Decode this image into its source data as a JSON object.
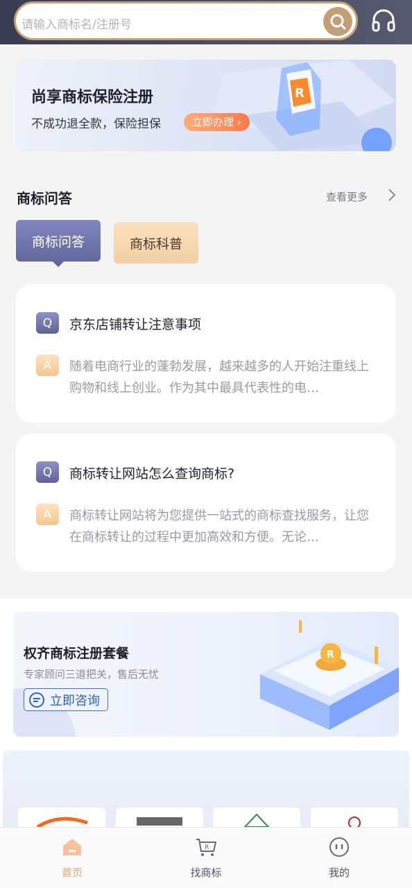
{
  "header": {
    "search_placeholder": "请输入商标名/注册号",
    "search_icon": "search-icon",
    "service_icon": "headset-icon"
  },
  "banner": {
    "title": "尚享商标保险注册",
    "subtitle": "不成功退全款，保险担保",
    "cta": "立即办理 ›"
  },
  "qa_section": {
    "title": "商标问答",
    "more": "查看更多",
    "tabs": [
      {
        "label": "商标问答",
        "active": true
      },
      {
        "label": "商标科普",
        "active": false
      }
    ],
    "items": [
      {
        "q_badge": "Q",
        "question": "京东店铺转让注意事项",
        "a_badge": "A",
        "answer": "随着电商行业的蓬勃发展，越来越多的人开始注重线上购物和线上创业。作为其中最具代表性的电…"
      },
      {
        "q_badge": "Q",
        "question": "商标转让网站怎么查询商标?",
        "a_badge": "A",
        "answer": "商标转让网站将为您提供一站式的商标查找服务，让您在商标转让的过程中更加高效和方便。无论…"
      }
    ]
  },
  "promo": {
    "title": "权齐商标注册套餐",
    "subtitle": "专家顾问三道把关，售后无忧",
    "cta": "立即咨询"
  },
  "nav": {
    "items": [
      {
        "label": "首页",
        "icon": "home-icon",
        "active": true
      },
      {
        "label": "找商标",
        "icon": "cart-icon",
        "active": false
      },
      {
        "label": "我的",
        "icon": "profile-icon",
        "active": false
      }
    ]
  },
  "colors": {
    "accent_gold": "#c39f78",
    "tab_active": "#63679c",
    "tab_inactive": "#f3cfa3",
    "link_blue": "#2e5fc9",
    "nav_active": "#e8a46f"
  }
}
